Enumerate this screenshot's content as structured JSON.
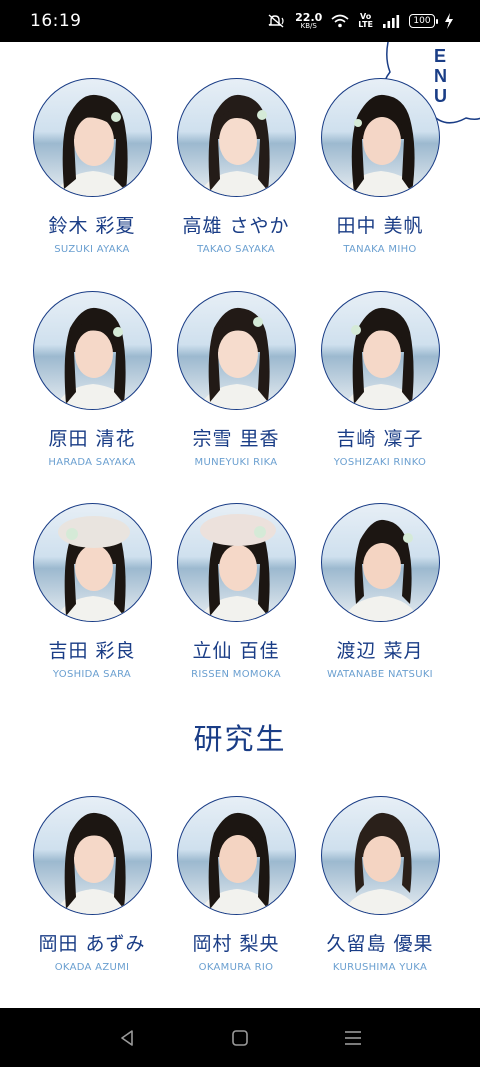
{
  "status_bar": {
    "time": "16:19",
    "net_speed": "22.0",
    "net_unit": "KB/S",
    "volte_top": "Vo",
    "volte_bottom": "LTE",
    "battery": "100",
    "icons": [
      "mute-icon",
      "wifi-icon",
      "signal-icon",
      "charging-icon"
    ]
  },
  "menu": {
    "line1": "M E",
    "line2": "N U"
  },
  "members": [
    {
      "jp": "鈴木 彩夏",
      "en": "SUZUKI AYAKA"
    },
    {
      "jp": "高雄 さやか",
      "en": "TAKAO SAYAKA"
    },
    {
      "jp": "田中 美帆",
      "en": "TANAKA MIHO"
    },
    {
      "jp": "原田 清花",
      "en": "HARADA SAYAKA"
    },
    {
      "jp": "宗雪 里香",
      "en": "MUNEYUKI RIKA"
    },
    {
      "jp": "吉崎 凜子",
      "en": "YOSHIZAKI RINKO"
    },
    {
      "jp": "吉田 彩良",
      "en": "YOSHIDA SARA"
    },
    {
      "jp": "立仙 百佳",
      "en": "RISSEN MOMOKA"
    },
    {
      "jp": "渡辺 菜月",
      "en": "WATANABE NATSUKI"
    }
  ],
  "trainee_section": {
    "title": "研究生"
  },
  "trainees": [
    {
      "jp": "岡田 あずみ",
      "en": "OKADA AZUMI"
    },
    {
      "jp": "岡村 梨央",
      "en": "OKAMURA RIO"
    },
    {
      "jp": "久留島 優果",
      "en": "KURUSHIMA YUKA"
    }
  ],
  "colors": {
    "accent": "#1a3d86",
    "subtext": "#6a9fd0",
    "background": "#ffffff"
  },
  "nav_bar": {
    "icons": [
      "back-icon",
      "home-icon",
      "recents-icon"
    ]
  }
}
